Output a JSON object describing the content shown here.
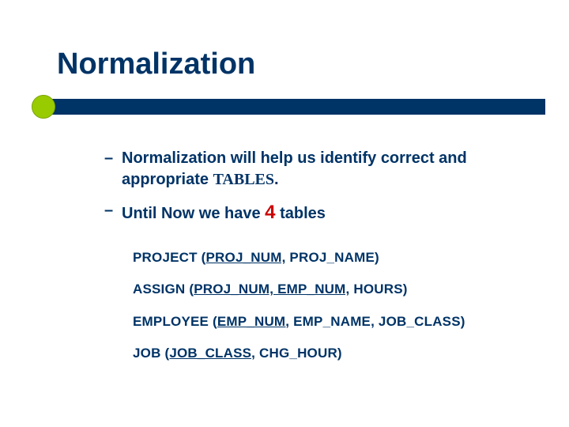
{
  "title": "Normalization",
  "bullets": {
    "b1_a": "Normalization will help us identify correct and appropriate ",
    "b1_tables": "TABLES",
    "b1_b": ".",
    "b2_a": "Until Now we have ",
    "b2_count": "4",
    "b2_b": " tables"
  },
  "schemas": {
    "s1": {
      "name": "PROJECT",
      "key": "PROJ_NUM,",
      "rest": " PROJ_NAME)"
    },
    "s2": {
      "name": "ASSIGN",
      "key": "PROJ_NUM, EMP_NUM,",
      "rest": " HOURS)"
    },
    "s3": {
      "name": "EMPLOYEE",
      "key": "EMP_NUM,",
      "rest": " EMP_NAME, JOB_CLASS)"
    },
    "s4": {
      "name": "JOB",
      "key": "JOB_CLASS,",
      "rest": " CHG_HOUR)"
    }
  },
  "paren_open": " ("
}
